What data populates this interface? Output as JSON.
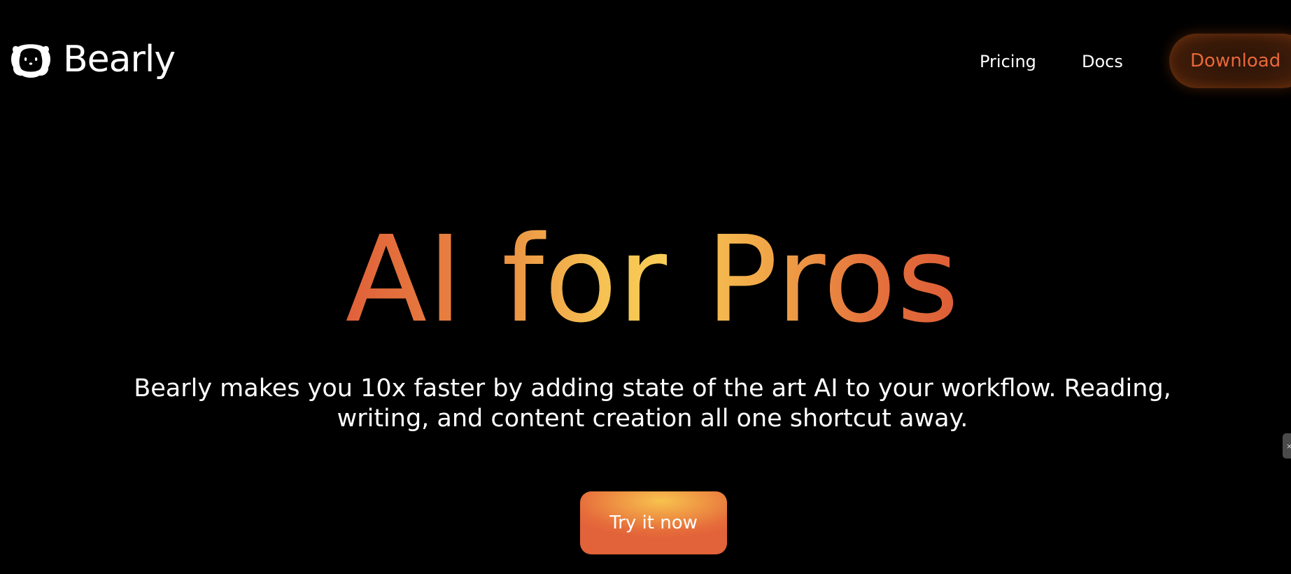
{
  "header": {
    "brand": {
      "name": "Bearly",
      "icon": "bear-face-icon"
    },
    "nav": {
      "pricing_label": "Pricing",
      "docs_label": "Docs",
      "download_label": "Download"
    }
  },
  "hero": {
    "title": "AI for Pros",
    "subtitle_line1": "Bearly makes you 10x faster by adding state of the art AI to your workflow. Reading,",
    "subtitle_line2": "writing, and content creation all one shortcut away.",
    "cta_label": "Try it now"
  },
  "side_tab": {
    "icon": "close-icon",
    "glyph": "×"
  },
  "colors": {
    "background": "#000000",
    "accent_orange": "#e8683a",
    "accent_yellow": "#f8cb56",
    "text": "#ffffff"
  }
}
